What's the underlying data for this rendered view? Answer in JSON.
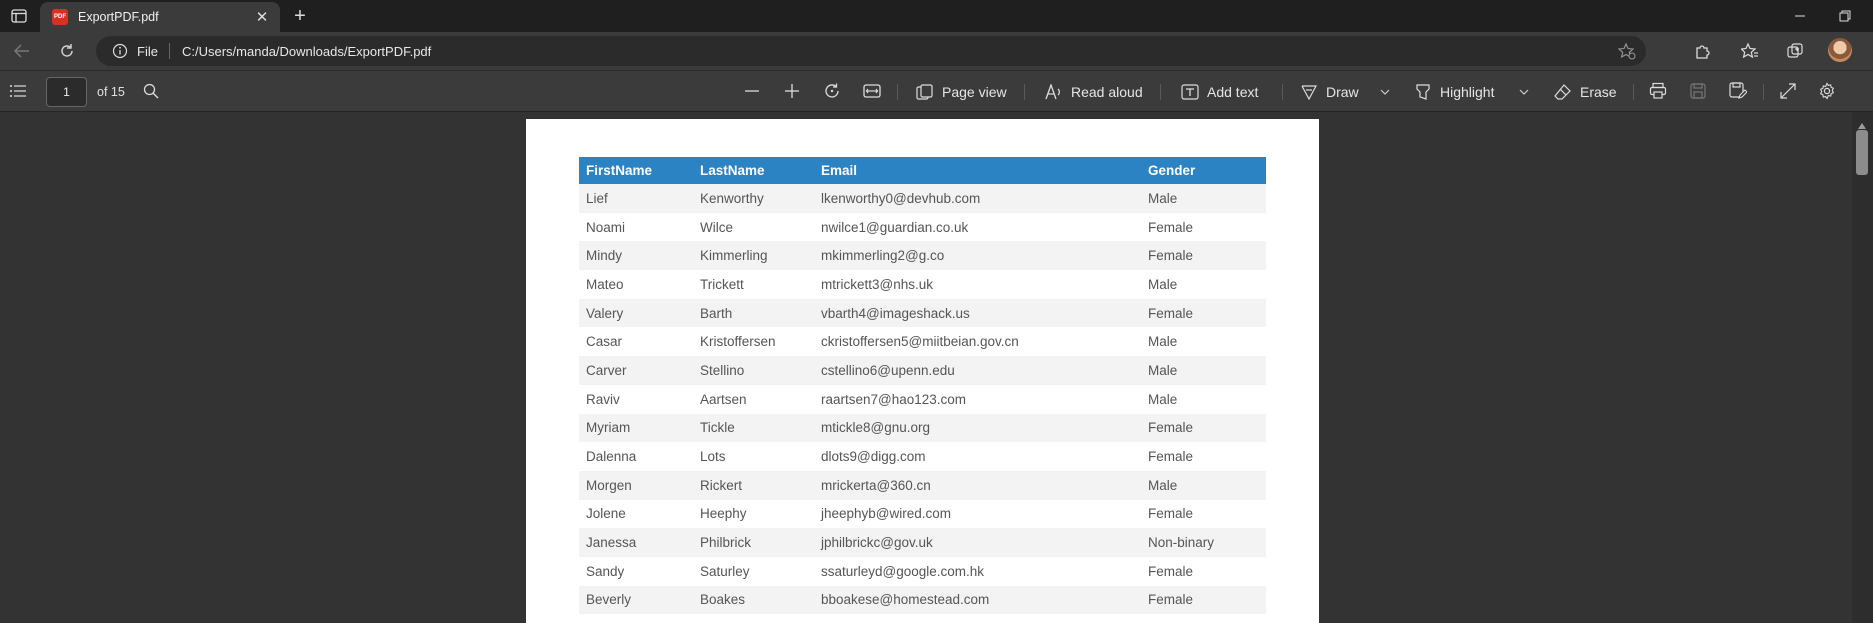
{
  "browser": {
    "tab": {
      "title": "ExportPDF.pdf",
      "close_label": "✕"
    },
    "newtab_label": "+",
    "address": {
      "scheme": "File",
      "url": "C:/Users/manda/Downloads/ExportPDF.pdf"
    }
  },
  "pdf_toolbar": {
    "page_current": "1",
    "page_count": "of 15",
    "page_view_label": "Page view",
    "read_aloud_label": "Read aloud",
    "add_text_label": "Add text",
    "draw_label": "Draw",
    "highlight_label": "Highlight",
    "erase_label": "Erase"
  },
  "table": {
    "headers": [
      "FirstName",
      "LastName",
      "Email",
      "Gender"
    ],
    "rows": [
      [
        "Lief",
        "Kenworthy",
        "lkenworthy0@devhub.com",
        "Male"
      ],
      [
        "Noami",
        "Wilce",
        "nwilce1@guardian.co.uk",
        "Female"
      ],
      [
        "Mindy",
        "Kimmerling",
        "mkimmerling2@g.co",
        "Female"
      ],
      [
        "Mateo",
        "Trickett",
        "mtrickett3@nhs.uk",
        "Male"
      ],
      [
        "Valery",
        "Barth",
        "vbarth4@imageshack.us",
        "Female"
      ],
      [
        "Casar",
        "Kristoffersen",
        "ckristoffersen5@miitbeian.gov.cn",
        "Male"
      ],
      [
        "Carver",
        "Stellino",
        "cstellino6@upenn.edu",
        "Male"
      ],
      [
        "Raviv",
        "Aartsen",
        "raartsen7@hao123.com",
        "Male"
      ],
      [
        "Myriam",
        "Tickle",
        "mtickle8@gnu.org",
        "Female"
      ],
      [
        "Dalenna",
        "Lots",
        "dlots9@digg.com",
        "Female"
      ],
      [
        "Morgen",
        "Rickert",
        "mrickerta@360.cn",
        "Male"
      ],
      [
        "Jolene",
        "Heephy",
        "jheephyb@wired.com",
        "Female"
      ],
      [
        "Janessa",
        "Philbrick",
        "jphilbrickc@gov.uk",
        "Non-binary"
      ],
      [
        "Sandy",
        "Saturley",
        "ssaturleyd@google.com.hk",
        "Female"
      ],
      [
        "Beverly",
        "Boakes",
        "bboakese@homestead.com",
        "Female"
      ]
    ]
  },
  "colors": {
    "header_blue": "#2b83c4",
    "pdf_red": "#d93025"
  }
}
